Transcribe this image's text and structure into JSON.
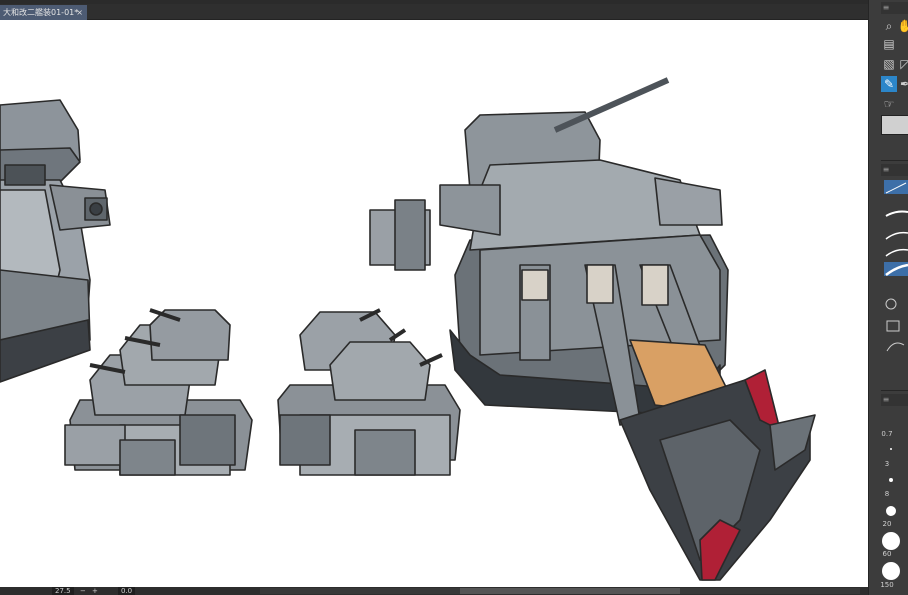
{
  "document": {
    "tab_title": "大和改二艦装01-01*",
    "close_glyph": "×"
  },
  "status": {
    "zoom": "27.5",
    "minus_glyph": "−",
    "plus_glyph": "+",
    "angle": "0.0"
  },
  "right_panel": {
    "menu_glyph": "≡",
    "brush_sizes": [
      "0.7",
      "3",
      "8",
      "20",
      "60",
      "150"
    ]
  },
  "icons": {
    "zoom": "magnifier-icon",
    "hand": "hand-icon",
    "navigator": "navigator-icon",
    "gradient": "gradient-icon",
    "eyedropper": "eyedropper-icon",
    "lasso": "lasso-icon",
    "pen": "pen-icon"
  }
}
